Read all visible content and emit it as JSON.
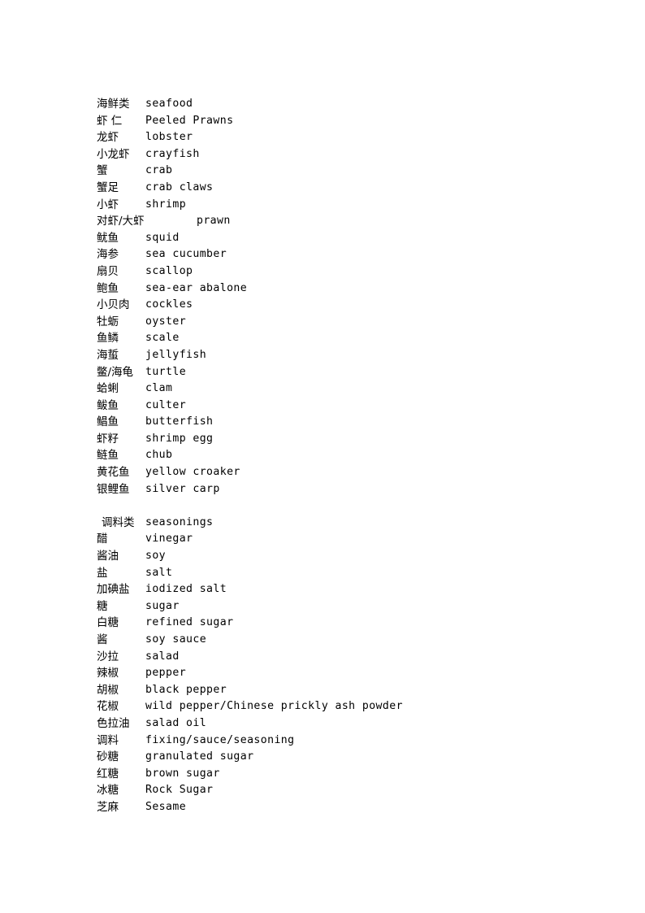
{
  "document": {
    "background_color": "#ffffff",
    "text_color": "#000000",
    "sections": [
      {
        "heading": {
          "term": "海鲜类",
          "gloss": "seafood"
        },
        "entries": [
          {
            "term": "虾 仁",
            "gloss": "Peeled Prawns"
          },
          {
            "term": "龙虾",
            "gloss": "lobster"
          },
          {
            "term": "小龙虾",
            "gloss": "crayfish"
          },
          {
            "term": "蟹",
            "gloss": "crab"
          },
          {
            "term": "蟹足",
            "gloss": "crab claws"
          },
          {
            "term": "小虾",
            "gloss": "shrimp"
          },
          {
            "term": "对虾/大虾",
            "gloss": "prawn"
          },
          {
            "term": "鱿鱼",
            "gloss": "squid"
          },
          {
            "term": "海参",
            "gloss": "sea cucumber"
          },
          {
            "term": "扇贝",
            "gloss": "scallop"
          },
          {
            "term": "鲍鱼",
            "gloss": "sea-ear abalone"
          },
          {
            "term": "小贝肉",
            "gloss": "cockles"
          },
          {
            "term": "牡蛎",
            "gloss": "oyster"
          },
          {
            "term": "鱼鳞",
            "gloss": "scale"
          },
          {
            "term": "海蜇",
            "gloss": "jellyfish"
          },
          {
            "term": "鳖/海龟",
            "gloss": "turtle"
          },
          {
            "term": "蛤蜊",
            "gloss": "clam"
          },
          {
            "term": "鲅鱼",
            "gloss": "culter"
          },
          {
            "term": "鲳鱼",
            "gloss": "butterfish"
          },
          {
            "term": "虾籽",
            "gloss": "shrimp egg"
          },
          {
            "term": "鲢鱼",
            "gloss": "chub"
          },
          {
            "term": "黄花鱼",
            "gloss": "yellow croaker"
          },
          {
            "term": "银鲤鱼",
            "gloss": "silver carp"
          }
        ]
      },
      {
        "heading": {
          "term": "调料类",
          "gloss": "seasonings"
        },
        "entries": [
          {
            "term": "醋",
            "gloss": "vinegar"
          },
          {
            "term": "酱油",
            "gloss": "soy"
          },
          {
            "term": "盐",
            "gloss": "salt"
          },
          {
            "term": "加碘盐",
            "gloss": "iodized salt"
          },
          {
            "term": "糖",
            "gloss": "sugar"
          },
          {
            "term": "白糖",
            "gloss": "refined sugar"
          },
          {
            "term": "酱",
            "gloss": "soy sauce"
          },
          {
            "term": "沙拉",
            "gloss": "salad"
          },
          {
            "term": "辣椒",
            "gloss": "pepper"
          },
          {
            "term": "胡椒",
            "gloss": "black pepper"
          },
          {
            "term": "花椒",
            "gloss": "wild pepper/Chinese prickly ash powder"
          },
          {
            "term": "色拉油",
            "gloss": "salad oil"
          },
          {
            "term": "调料",
            "gloss": "fixing/sauce/seasoning"
          },
          {
            "term": "砂糖",
            "gloss": "granulated sugar"
          },
          {
            "term": "红糖",
            "gloss": "brown sugar"
          },
          {
            "term": "冰糖",
            "gloss": "Rock Sugar"
          },
          {
            "term": "芝麻",
            "gloss": "Sesame"
          }
        ]
      }
    ]
  }
}
